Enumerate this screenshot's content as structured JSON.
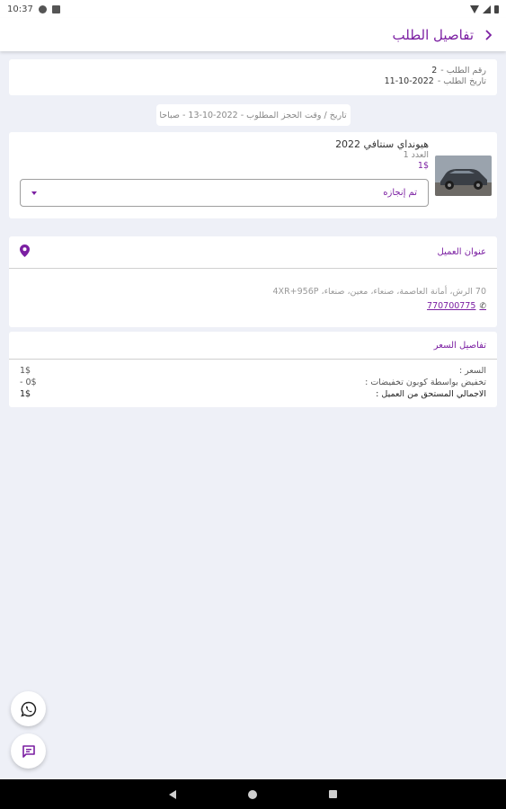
{
  "status_bar": {
    "time": "10:37"
  },
  "app_bar": {
    "title": "تفاصيل الطلب"
  },
  "order": {
    "number_label": "رقم الطلب -",
    "number_value": "2",
    "date_label": "تاريخ الطلب -",
    "date_value": "11-10-2022"
  },
  "booking": {
    "text": "تاريخ / وقت الحجز المطلوب - 2022-10-13 - صباحا"
  },
  "product": {
    "name": "هيونداي سنتافي 2022",
    "quantity": "العدد 1",
    "price": "1$",
    "image_icon": "car-image",
    "status_value": "تم إنجازه"
  },
  "address": {
    "section_title": "عنوان العميل",
    "pin_icon": "location-pin-icon",
    "text": "70 الرش، أمانة العاصمة، صنعاء، معين، صنعاء، 4XR+956P",
    "phone": "770700775",
    "phone_icon": "phone-icon"
  },
  "price": {
    "section_title": "تفاصيل السعر",
    "rows": [
      {
        "label": "السعر :",
        "amount": "1$"
      },
      {
        "label": "تخفيض بواسطة كوبون تخفيضات :",
        "amount": "- 0$"
      },
      {
        "label": "الاجمالي المستحق من العميل :",
        "amount": "1$"
      }
    ]
  },
  "fabs": {
    "whatsapp_icon": "whatsapp-icon",
    "chat_icon": "chat-icon"
  },
  "colors": {
    "accent": "#7b1fa2",
    "background": "#eef0f7",
    "card": "#ffffff"
  }
}
